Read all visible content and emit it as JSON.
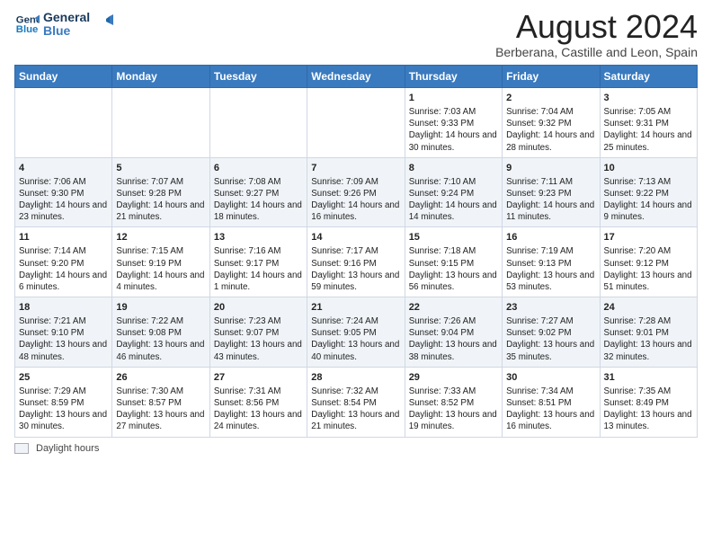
{
  "logo": {
    "line1": "General",
    "line2": "Blue"
  },
  "title": "August 2024",
  "subtitle": "Berberana, Castille and Leon, Spain",
  "headers": [
    "Sunday",
    "Monday",
    "Tuesday",
    "Wednesday",
    "Thursday",
    "Friday",
    "Saturday"
  ],
  "weeks": [
    [
      {
        "day": "",
        "text": ""
      },
      {
        "day": "",
        "text": ""
      },
      {
        "day": "",
        "text": ""
      },
      {
        "day": "",
        "text": ""
      },
      {
        "day": "1",
        "text": "Sunrise: 7:03 AM\nSunset: 9:33 PM\nDaylight: 14 hours and 30 minutes."
      },
      {
        "day": "2",
        "text": "Sunrise: 7:04 AM\nSunset: 9:32 PM\nDaylight: 14 hours and 28 minutes."
      },
      {
        "day": "3",
        "text": "Sunrise: 7:05 AM\nSunset: 9:31 PM\nDaylight: 14 hours and 25 minutes."
      }
    ],
    [
      {
        "day": "4",
        "text": "Sunrise: 7:06 AM\nSunset: 9:30 PM\nDaylight: 14 hours and 23 minutes."
      },
      {
        "day": "5",
        "text": "Sunrise: 7:07 AM\nSunset: 9:28 PM\nDaylight: 14 hours and 21 minutes."
      },
      {
        "day": "6",
        "text": "Sunrise: 7:08 AM\nSunset: 9:27 PM\nDaylight: 14 hours and 18 minutes."
      },
      {
        "day": "7",
        "text": "Sunrise: 7:09 AM\nSunset: 9:26 PM\nDaylight: 14 hours and 16 minutes."
      },
      {
        "day": "8",
        "text": "Sunrise: 7:10 AM\nSunset: 9:24 PM\nDaylight: 14 hours and 14 minutes."
      },
      {
        "day": "9",
        "text": "Sunrise: 7:11 AM\nSunset: 9:23 PM\nDaylight: 14 hours and 11 minutes."
      },
      {
        "day": "10",
        "text": "Sunrise: 7:13 AM\nSunset: 9:22 PM\nDaylight: 14 hours and 9 minutes."
      }
    ],
    [
      {
        "day": "11",
        "text": "Sunrise: 7:14 AM\nSunset: 9:20 PM\nDaylight: 14 hours and 6 minutes."
      },
      {
        "day": "12",
        "text": "Sunrise: 7:15 AM\nSunset: 9:19 PM\nDaylight: 14 hours and 4 minutes."
      },
      {
        "day": "13",
        "text": "Sunrise: 7:16 AM\nSunset: 9:17 PM\nDaylight: 14 hours and 1 minute."
      },
      {
        "day": "14",
        "text": "Sunrise: 7:17 AM\nSunset: 9:16 PM\nDaylight: 13 hours and 59 minutes."
      },
      {
        "day": "15",
        "text": "Sunrise: 7:18 AM\nSunset: 9:15 PM\nDaylight: 13 hours and 56 minutes."
      },
      {
        "day": "16",
        "text": "Sunrise: 7:19 AM\nSunset: 9:13 PM\nDaylight: 13 hours and 53 minutes."
      },
      {
        "day": "17",
        "text": "Sunrise: 7:20 AM\nSunset: 9:12 PM\nDaylight: 13 hours and 51 minutes."
      }
    ],
    [
      {
        "day": "18",
        "text": "Sunrise: 7:21 AM\nSunset: 9:10 PM\nDaylight: 13 hours and 48 minutes."
      },
      {
        "day": "19",
        "text": "Sunrise: 7:22 AM\nSunset: 9:08 PM\nDaylight: 13 hours and 46 minutes."
      },
      {
        "day": "20",
        "text": "Sunrise: 7:23 AM\nSunset: 9:07 PM\nDaylight: 13 hours and 43 minutes."
      },
      {
        "day": "21",
        "text": "Sunrise: 7:24 AM\nSunset: 9:05 PM\nDaylight: 13 hours and 40 minutes."
      },
      {
        "day": "22",
        "text": "Sunrise: 7:26 AM\nSunset: 9:04 PM\nDaylight: 13 hours and 38 minutes."
      },
      {
        "day": "23",
        "text": "Sunrise: 7:27 AM\nSunset: 9:02 PM\nDaylight: 13 hours and 35 minutes."
      },
      {
        "day": "24",
        "text": "Sunrise: 7:28 AM\nSunset: 9:01 PM\nDaylight: 13 hours and 32 minutes."
      }
    ],
    [
      {
        "day": "25",
        "text": "Sunrise: 7:29 AM\nSunset: 8:59 PM\nDaylight: 13 hours and 30 minutes."
      },
      {
        "day": "26",
        "text": "Sunrise: 7:30 AM\nSunset: 8:57 PM\nDaylight: 13 hours and 27 minutes."
      },
      {
        "day": "27",
        "text": "Sunrise: 7:31 AM\nSunset: 8:56 PM\nDaylight: 13 hours and 24 minutes."
      },
      {
        "day": "28",
        "text": "Sunrise: 7:32 AM\nSunset: 8:54 PM\nDaylight: 13 hours and 21 minutes."
      },
      {
        "day": "29",
        "text": "Sunrise: 7:33 AM\nSunset: 8:52 PM\nDaylight: 13 hours and 19 minutes."
      },
      {
        "day": "30",
        "text": "Sunrise: 7:34 AM\nSunset: 8:51 PM\nDaylight: 13 hours and 16 minutes."
      },
      {
        "day": "31",
        "text": "Sunrise: 7:35 AM\nSunset: 8:49 PM\nDaylight: 13 hours and 13 minutes."
      }
    ]
  ],
  "legend": {
    "label": "Daylight hours"
  }
}
